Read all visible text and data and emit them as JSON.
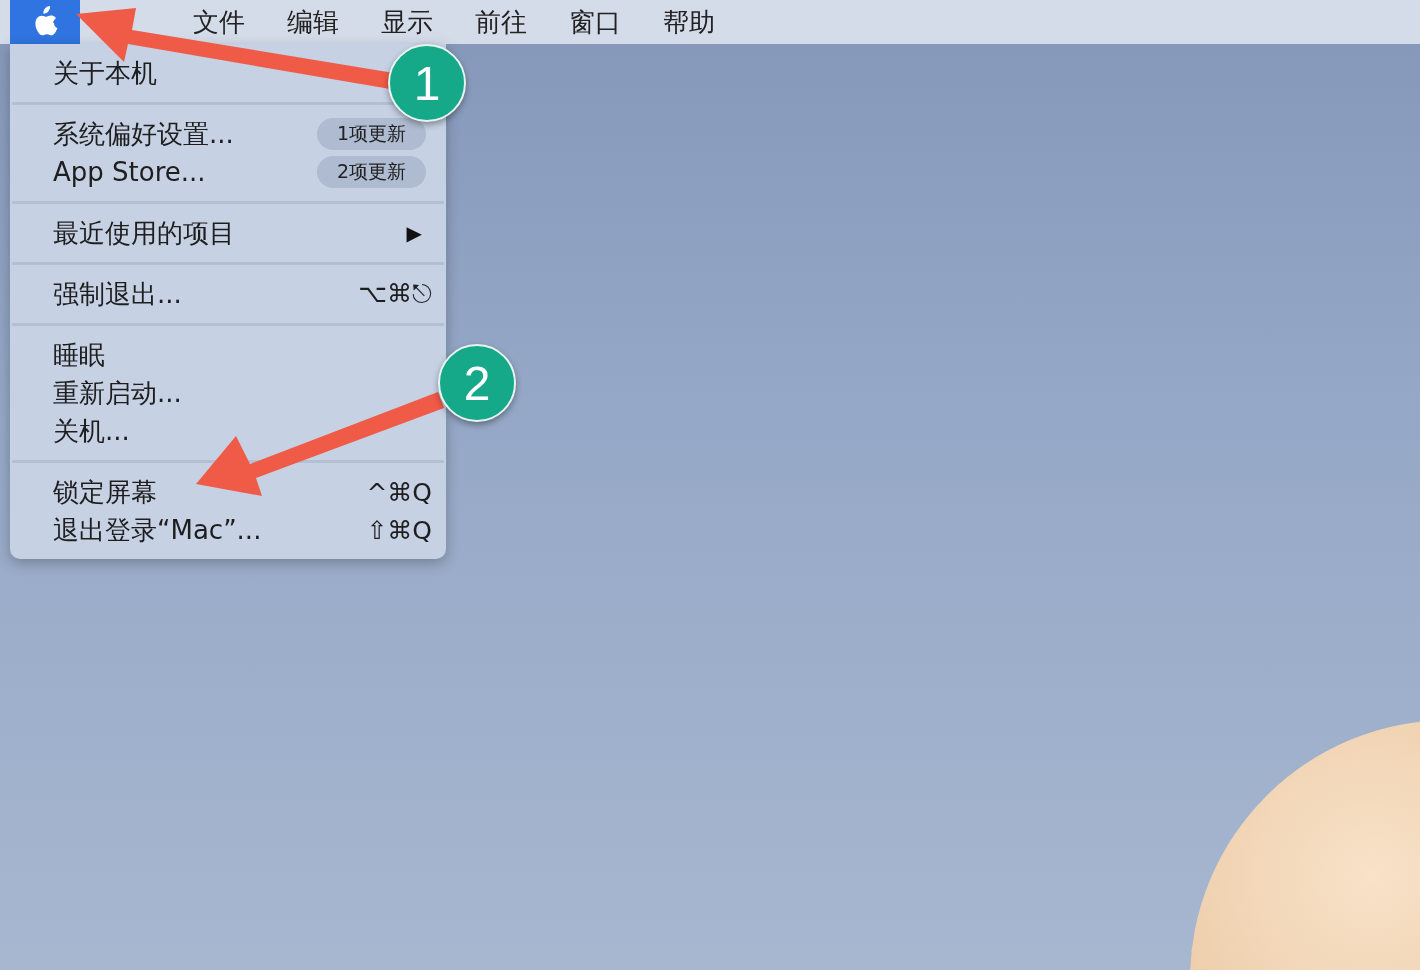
{
  "menu_bar": {
    "items": [
      {
        "kind": "apple",
        "selected": true
      },
      {
        "kind": "title",
        "label": "文件",
        "selected": false
      },
      {
        "kind": "title",
        "label": "编辑",
        "selected": false
      },
      {
        "kind": "title",
        "label": "显示",
        "selected": false
      },
      {
        "kind": "title",
        "label": "前往",
        "selected": false
      },
      {
        "kind": "title",
        "label": "窗口",
        "selected": false
      },
      {
        "kind": "title",
        "label": "帮助",
        "selected": false
      }
    ]
  },
  "apple_menu": {
    "sections": [
      [
        {
          "label": "关于本机"
        }
      ],
      [
        {
          "label": "系统偏好设置...",
          "badge": "1项更新"
        },
        {
          "label": "App Store...",
          "badge": "2项更新"
        }
      ],
      [
        {
          "label": "最近使用的项目",
          "submenu_indicator": "▶"
        }
      ],
      [
        {
          "label": "强制退出...",
          "shortcut": "⌥⌘⎋"
        }
      ],
      [
        {
          "label": "睡眠"
        },
        {
          "label": "重新启动..."
        },
        {
          "label": "关机..."
        }
      ],
      [
        {
          "label": "锁定屏幕",
          "shortcut": "^⌘Q"
        },
        {
          "label": "退出登录“Mac”...",
          "shortcut": "⇧⌘Q"
        }
      ]
    ]
  },
  "annotations": [
    {
      "number": "1"
    },
    {
      "number": "2"
    }
  ]
}
